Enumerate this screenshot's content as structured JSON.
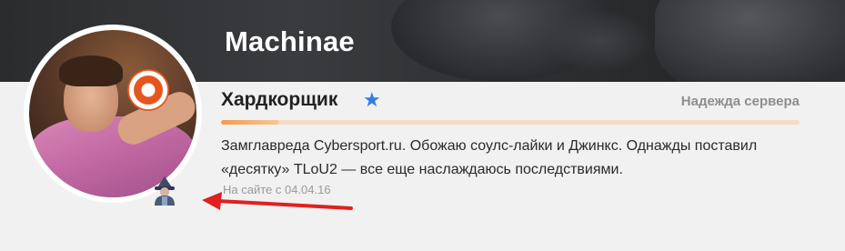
{
  "profile": {
    "username": "Machinae",
    "rank": {
      "name": "Хардкорщик",
      "title": "Надежда сервера",
      "progress_percent": 10
    },
    "bio_line1": "Замглавреда Cybersport.ru. Обожаю соулс-лайки и Джинкс. Однажды поставил",
    "bio_line2": "«десятку» TLoU2 — все еще наслаждаюсь последствиями.",
    "member_since": "На сайте с 04.04.16"
  },
  "icons": {
    "star": "star-icon",
    "badge": "hacker-badge-icon",
    "arrow": "red-arrow-annotation"
  },
  "colors": {
    "star": "#2e7de0",
    "progress_fill": "#f59a4b",
    "progress_track": "#f6dcc6",
    "arrow": "#e02020"
  }
}
